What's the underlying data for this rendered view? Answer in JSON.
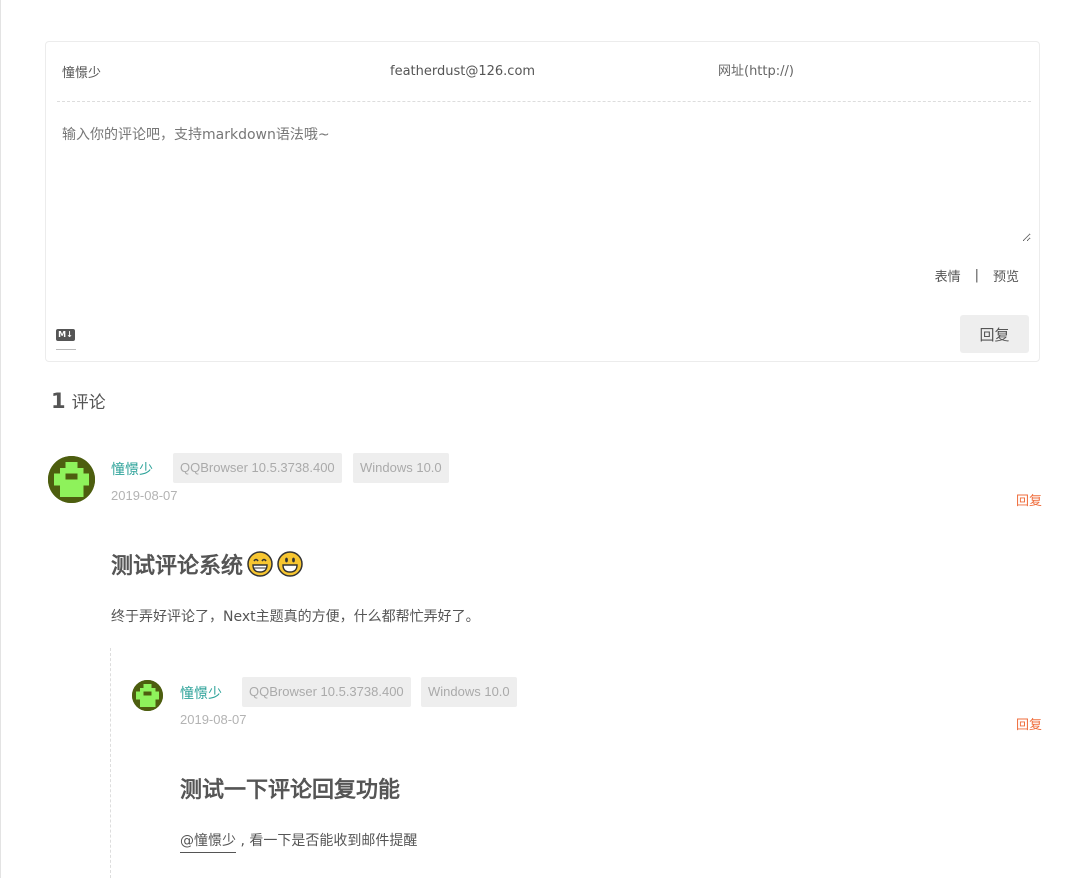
{
  "form": {
    "nickname_value": "憧憬少",
    "email_value": "featherdust@126.com",
    "website_placeholder": "网址(http://)",
    "comment_placeholder": "输入你的评论吧，支持markdown语法哦~",
    "emoji_label": "表情",
    "separator": "|",
    "preview_label": "预览",
    "markdown_badge": "M↓",
    "submit_label": "回复"
  },
  "count": {
    "number": "1",
    "label": "评论"
  },
  "comments": [
    {
      "nick": "憧憬少",
      "browser": "QQBrowser 10.5.3738.400",
      "os": "Windows 10.0",
      "time": "2019-08-07",
      "reply_label": "回复",
      "title": "测试评论系统",
      "emojis": [
        "grinning-face-with-smiling-eyes",
        "grinning-face"
      ],
      "body": "终于弄好评论了，Next主题真的方便，什么都帮忙弄好了。",
      "replies": [
        {
          "nick": "憧憬少",
          "browser": "QQBrowser 10.5.3738.400",
          "os": "Windows 10.0",
          "time": "2019-08-07",
          "reply_label": "回复",
          "title": "测试一下评论回复功能",
          "mention": "@憧憬少",
          "body": " , 看一下是否能收到邮件提醒"
        }
      ]
    }
  ],
  "colors": {
    "nick": "#2ea39a",
    "reply": "#ef6d3c",
    "tag_bg": "#eeeeee",
    "avatar_bg": "#4d5e0f",
    "avatar_fg": "#8ef25b"
  }
}
